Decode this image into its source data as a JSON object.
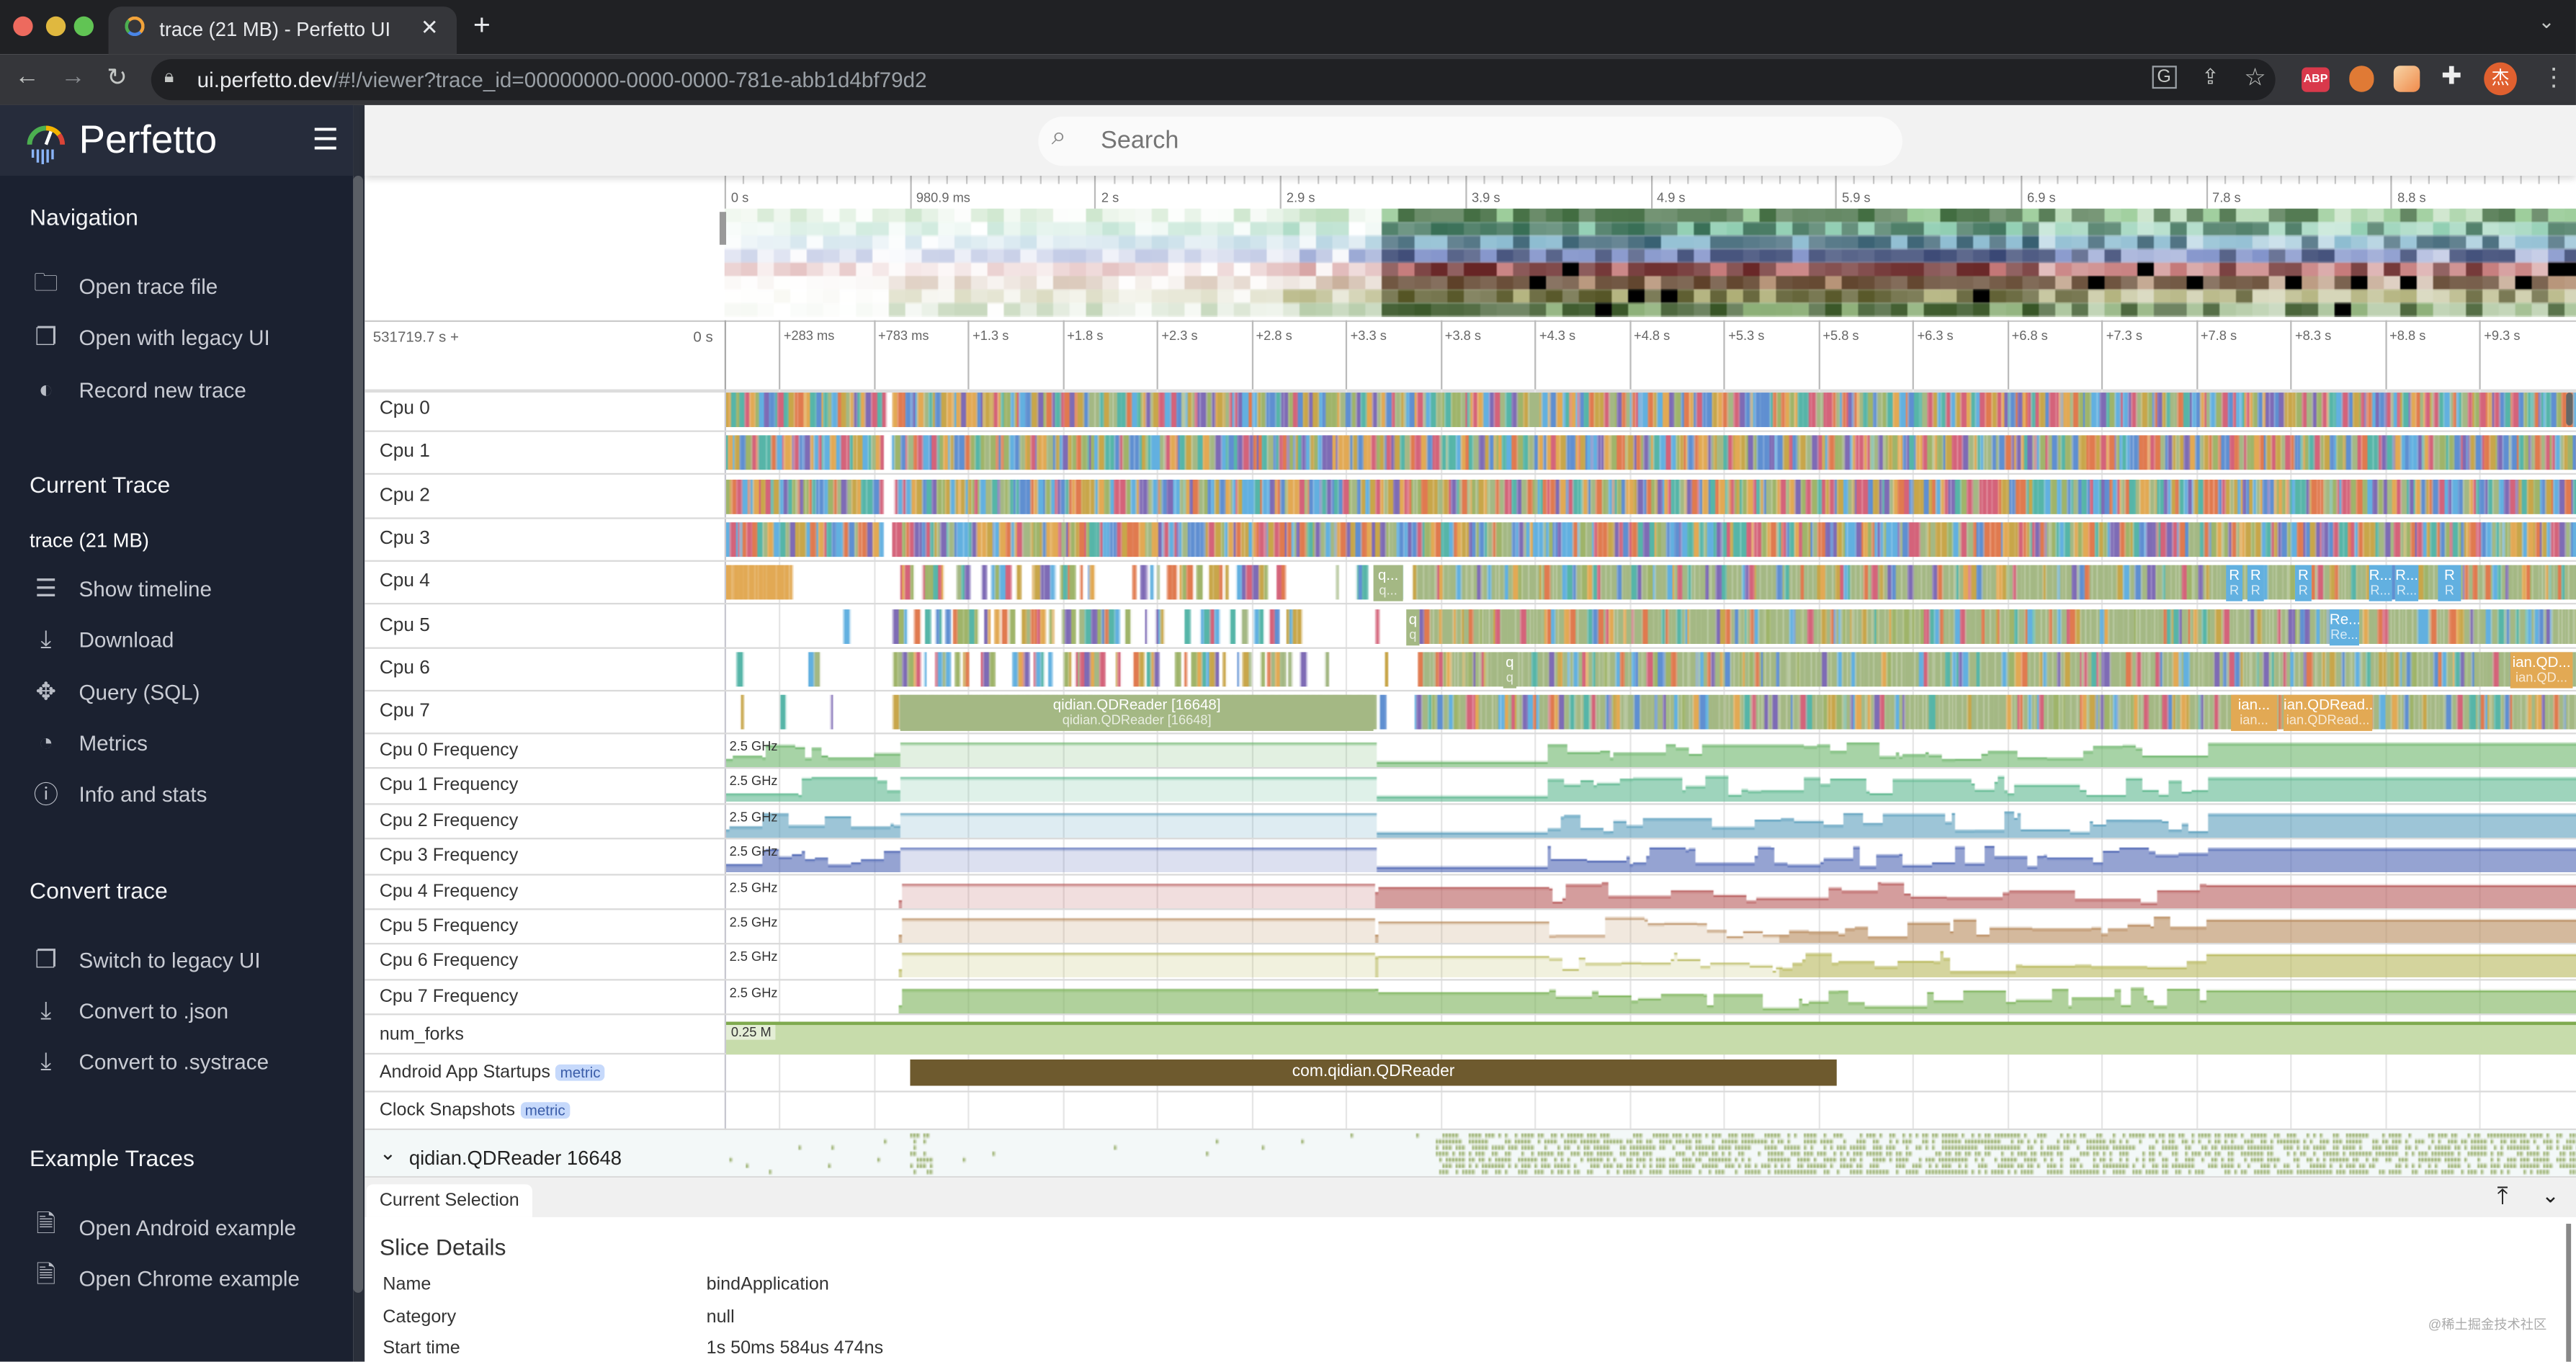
{
  "browser": {
    "tab_title": "trace (21 MB) - Perfetto UI",
    "url_host": "ui.perfetto.dev",
    "url_path": "/#!/viewer?trace_id=00000000-0000-0000-781e-abb1d4bf79d2",
    "profile_initial": "杰",
    "extension_abp": "ABP"
  },
  "sidebar": {
    "logo": "Perfetto",
    "sections": [
      {
        "title": "Navigation",
        "items": [
          {
            "label": "Open trace file",
            "icon": "folder-icon"
          },
          {
            "label": "Open with legacy UI",
            "icon": "filter-none-icon"
          },
          {
            "label": "Record new trace",
            "icon": "record-icon"
          }
        ]
      },
      {
        "title": "Current Trace",
        "subtitle": "trace (21 MB)",
        "items": [
          {
            "label": "Show timeline",
            "icon": "timeline-icon"
          },
          {
            "label": "Download",
            "icon": "download-icon"
          },
          {
            "label": "Query (SQL)",
            "icon": "query-icon"
          },
          {
            "label": "Metrics",
            "icon": "speedometer-icon"
          },
          {
            "label": "Info and stats",
            "icon": "info-icon"
          }
        ]
      },
      {
        "title": "Convert trace",
        "items": [
          {
            "label": "Switch to legacy UI",
            "icon": "filter-none-icon"
          },
          {
            "label": "Convert to .json",
            "icon": "download-icon"
          },
          {
            "label": "Convert to .systrace",
            "icon": "download-icon"
          }
        ]
      },
      {
        "title": "Example Traces",
        "items": [
          {
            "label": "Open Android example",
            "icon": "description-icon"
          },
          {
            "label": "Open Chrome example",
            "icon": "description-icon"
          }
        ]
      }
    ]
  },
  "search": {
    "placeholder": "Search"
  },
  "overview": {
    "ticks": [
      "0 s",
      "980.9 ms",
      "2 s",
      "2.9 s",
      "3.9 s",
      "4.9 s",
      "5.9 s",
      "6.9 s",
      "7.8 s",
      "8.8 s"
    ]
  },
  "time_axis": {
    "offset": "531719.7 s +",
    "zero": "0 s",
    "ticks": [
      "+283 ms",
      "+783 ms",
      "+1.3 s",
      "+1.8 s",
      "+2.3 s",
      "+2.8 s",
      "+3.3 s",
      "+3.8 s",
      "+4.3 s",
      "+4.8 s",
      "+5.3 s",
      "+5.8 s",
      "+6.3 s",
      "+6.8 s",
      "+7.3 s",
      "+7.8 s",
      "+8.3 s",
      "+8.8 s",
      "+9.3 s"
    ]
  },
  "cpu_tracks": [
    "Cpu 0",
    "Cpu 1",
    "Cpu 2",
    "Cpu 3",
    "Cpu 4",
    "Cpu 5",
    "Cpu 6",
    "Cpu 7"
  ],
  "cpu_slice_labels": {
    "cpu4": [
      "q...",
      "R",
      "R",
      "R",
      "R...",
      "R...",
      "R"
    ],
    "cpu5": [
      "q",
      "Re..."
    ],
    "cpu6": [
      "q",
      "ian.QD..."
    ],
    "cpu7": {
      "main": "qidian.QDReader [16648]",
      "others": [
        "ian...",
        "ian.QDRead..."
      ]
    }
  },
  "freq_tracks": [
    {
      "label": "Cpu 0 Frequency",
      "max": "2.5 GHz",
      "color": "#6db56b"
    },
    {
      "label": "Cpu 1 Frequency",
      "max": "2.5 GHz",
      "color": "#5eb88f"
    },
    {
      "label": "Cpu 2 Frequency",
      "max": "2.5 GHz",
      "color": "#5b9fbd"
    },
    {
      "label": "Cpu 3 Frequency",
      "max": "2.5 GHz",
      "color": "#4e66b4"
    },
    {
      "label": "Cpu 4 Frequency",
      "max": "2.5 GHz",
      "color": "#b85c5c"
    },
    {
      "label": "Cpu 5 Frequency",
      "max": "2.5 GHz",
      "color": "#b88a5c"
    },
    {
      "label": "Cpu 6 Frequency",
      "max": "2.5 GHz",
      "color": "#b8b85c"
    },
    {
      "label": "Cpu 7 Frequency",
      "max": "2.5 GHz",
      "color": "#7cb35a"
    }
  ],
  "num_forks": {
    "label": "num_forks",
    "max": "0.25 M"
  },
  "startups": {
    "label": "Android App Startups",
    "badge": "metric",
    "slice": "com.qidian.QDReader"
  },
  "clock": {
    "label": "Clock Snapshots",
    "badge": "metric"
  },
  "process": {
    "label": "qidian.QDReader 16648"
  },
  "details": {
    "tab": "Current Selection",
    "title": "Slice Details",
    "rows": [
      {
        "key": "Name",
        "value": "bindApplication"
      },
      {
        "key": "Category",
        "value": "null"
      },
      {
        "key": "Start time",
        "value": "1s 50ms 584us 474ns"
      }
    ]
  },
  "watermark": "@稀土掘金技术社区"
}
